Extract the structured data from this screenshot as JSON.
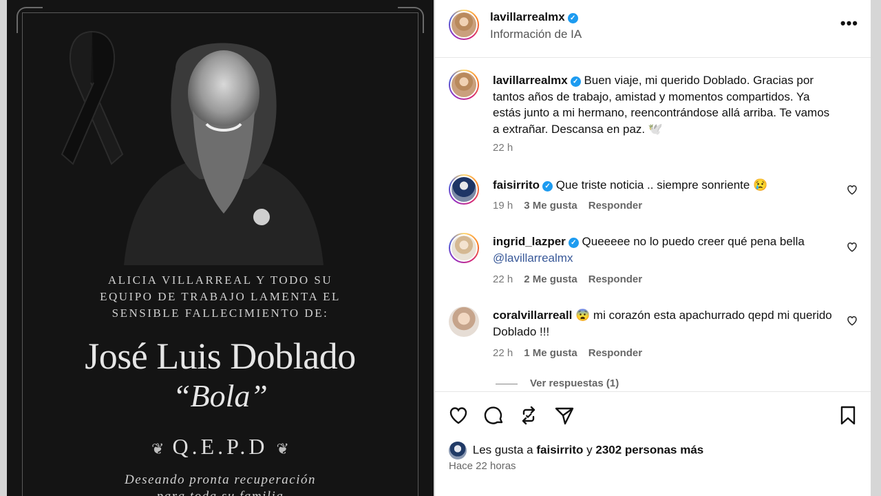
{
  "image": {
    "announcement_lines": [
      "ALICIA VILLARREAL Y TODO SU",
      "EQUIPO DE TRABAJO LAMENTA EL",
      "SENSIBLE FALLECIMIENTO DE:"
    ],
    "name": "José Luis Doblado",
    "nickname": "“Bola”",
    "qepd": "Q.E.P.D",
    "wish_lines": [
      "Deseando pronta recuperación",
      "para toda su familia"
    ]
  },
  "header": {
    "username": "lavillarrealmx",
    "subtitle": "Información de IA",
    "more": "•••"
  },
  "caption": {
    "username": "lavillarrealmx",
    "text": "Buen viaje, mi querido Doblado. Gracias por tantos años de trabajo, amistad y momentos compartidos. Ya estás junto a mi hermano, reencontrándose allá arriba. Te vamos a extrañar. Descansa en paz. 🕊️",
    "time": "22 h"
  },
  "comments": [
    {
      "username": "faisirrito",
      "text": "Que triste noticia .. siempre sonriente 😢",
      "time": "19 h",
      "likes": "3 Me gusta",
      "reply": "Responder"
    },
    {
      "username": "ingrid_lazper",
      "text": "Queeeee no lo puedo creer qué pena bella",
      "mention": "@lavillarrealmx",
      "time": "22 h",
      "likes": "2 Me gusta",
      "reply": "Responder"
    },
    {
      "username": "coralvillarreall",
      "text": "😨 mi corazón esta apachurrado qepd mi querido Doblado !!!",
      "time": "22 h",
      "likes": "1 Me gusta",
      "reply": "Responder"
    }
  ],
  "view_replies": "Ver respuestas (1)",
  "likes_summary": {
    "prefix": "Les gusta a",
    "user": "faisirrito",
    "connector": "y",
    "others": "2302 personas más"
  },
  "posted": "Hace 22 horas",
  "icons": [
    "heart-icon",
    "comment-icon",
    "repost-icon",
    "share-icon",
    "bookmark-icon"
  ]
}
